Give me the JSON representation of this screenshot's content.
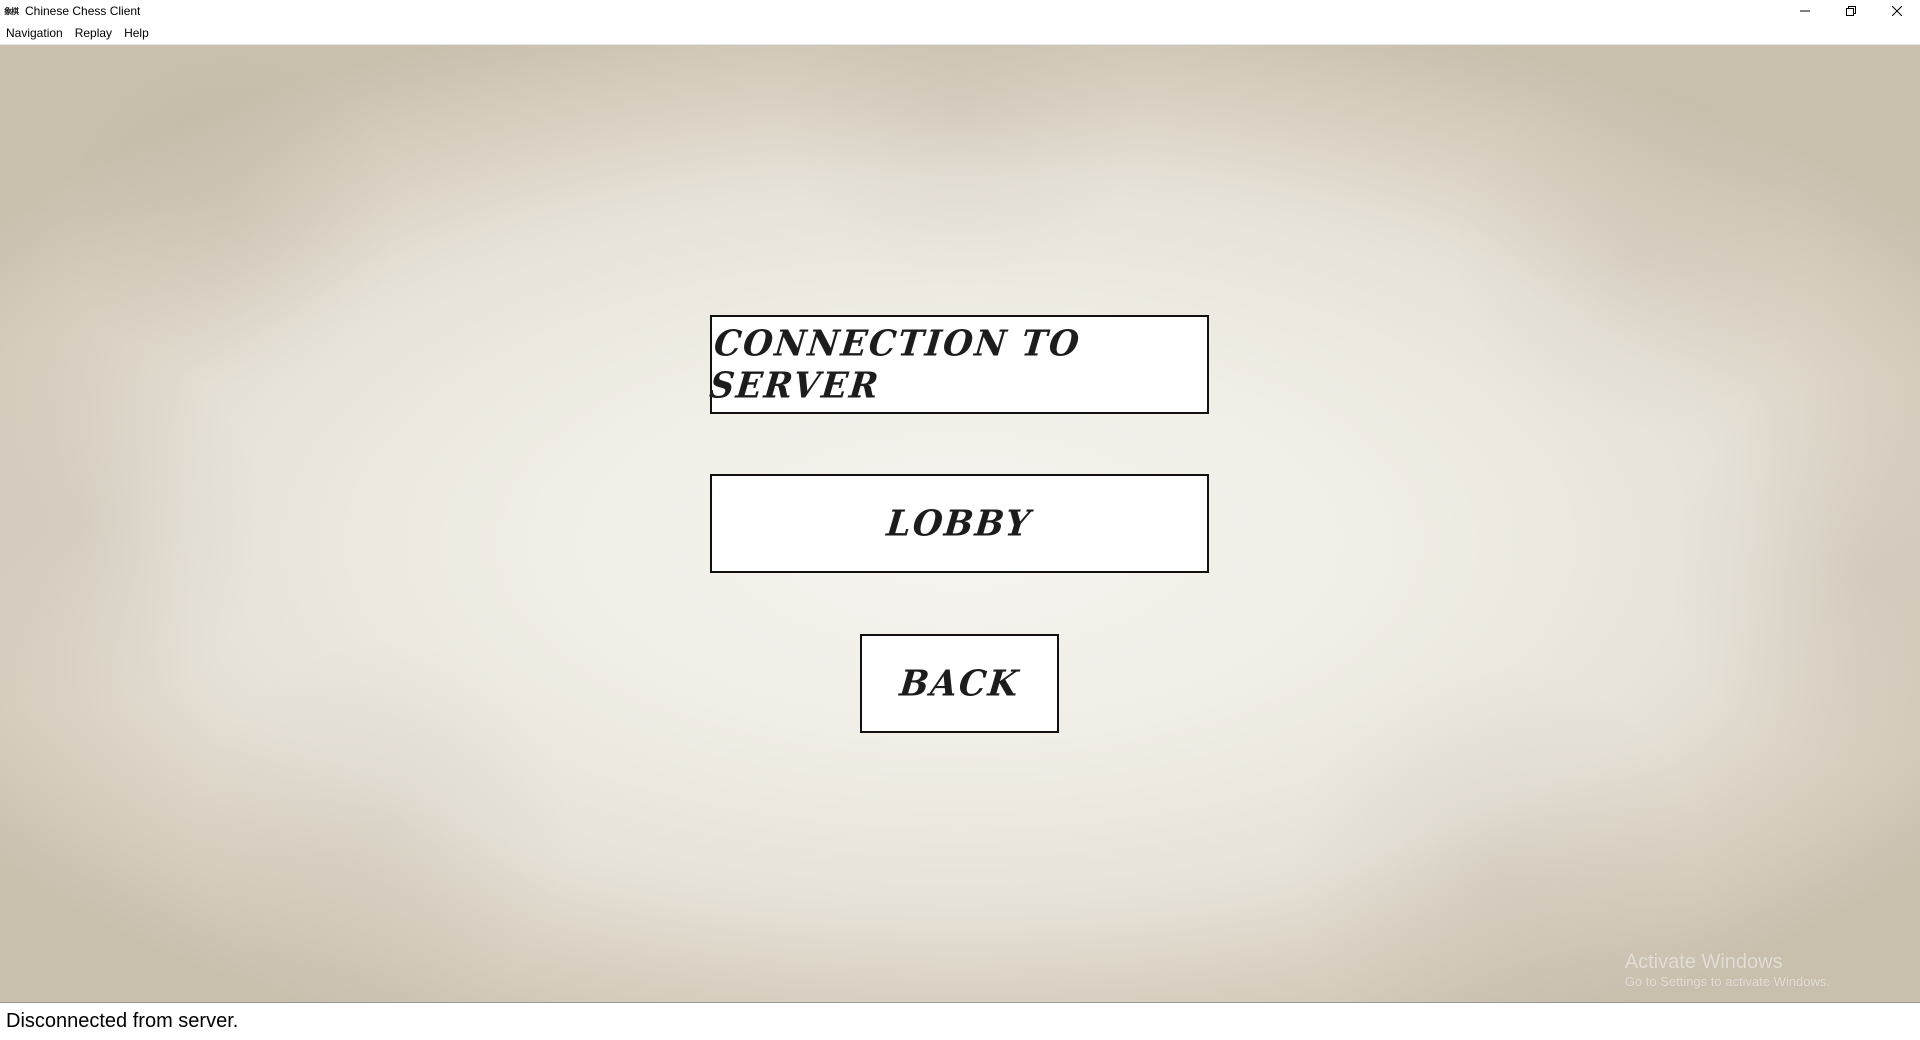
{
  "window": {
    "title": "Chinese Chess Client",
    "icon": "chess-app-icon",
    "icon_text": "象棋"
  },
  "menu": {
    "items": [
      {
        "label": "Navigation"
      },
      {
        "label": "Replay"
      },
      {
        "label": "Help"
      }
    ]
  },
  "main": {
    "buttons": {
      "connection": "CONNECTION TO SERVER",
      "lobby": "LOBBY",
      "back": "BACK"
    },
    "watermark": {
      "title": "Activate Windows",
      "subtitle": "Go to Settings to activate Windows."
    }
  },
  "status": {
    "text": "Disconnected from server."
  },
  "colors": {
    "button_border": "#111111",
    "button_bg": "#ffffff",
    "paper_center": "#f6f4ef",
    "paper_edge": "#c8bfad"
  }
}
